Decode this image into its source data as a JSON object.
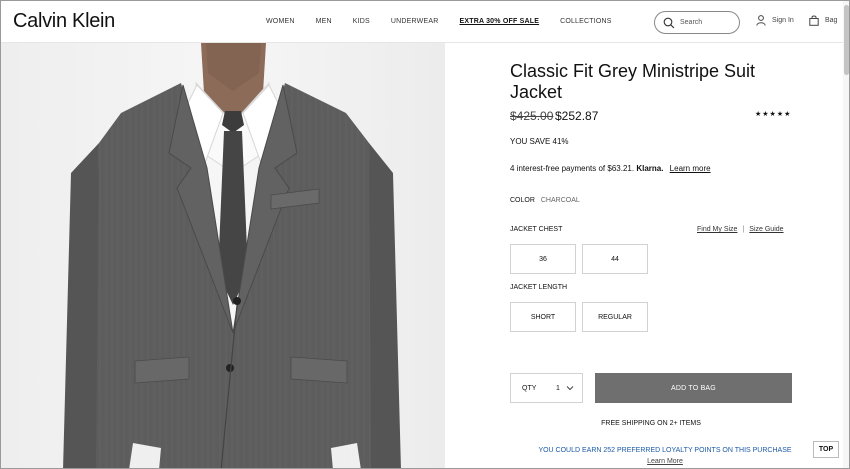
{
  "header": {
    "logo": "Calvin Klein",
    "nav": [
      "WOMEN",
      "MEN",
      "KIDS",
      "UNDERWEAR",
      "EXTRA 30% OFF SALE",
      "COLLECTIONS"
    ],
    "search_placeholder": "Search",
    "signin": "Sign In",
    "bag": "Bag"
  },
  "product": {
    "title": "Classic Fit Grey Ministripe Suit Jacket",
    "price_original": "$425.00",
    "price_sale": "$252.87",
    "rating_stars": "★★★★★",
    "you_save": "YOU SAVE 41%",
    "klarna_text": "4 interest-free payments of $63.21.",
    "klarna_brand": "Klarna.",
    "klarna_link": "Learn more",
    "color_label": "COLOR",
    "color_value": "CHARCOAL",
    "chest_label": "JACKET CHEST",
    "find_my_size": "Find My Size",
    "size_separator": "|",
    "size_guide": "Size Guide",
    "chest_options": [
      "36",
      "44"
    ],
    "length_label": "JACKET LENGTH",
    "length_options": [
      "SHORT",
      "REGULAR"
    ],
    "qty_label": "QTY",
    "qty_value": "1",
    "add_to_bag": "ADD TO BAG",
    "free_shipping": "FREE SHIPPING ON 2+ ITEMS",
    "loyalty": "YOU COULD EARN 252 PREFERRED LOYALTY POINTS ON THIS PURCHASE",
    "loyalty_link": "Learn More",
    "top_button": "TOP"
  },
  "colors": {
    "add_to_bag_bg": "#6f6f6f",
    "loyalty_text": "#1c5aa6",
    "suit": "#5b5b5b"
  }
}
